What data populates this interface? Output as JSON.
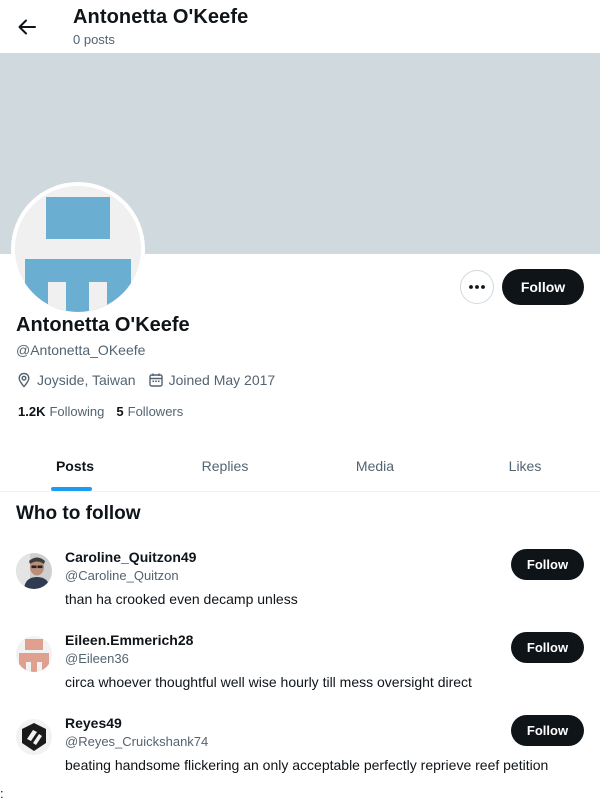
{
  "header": {
    "back_icon": "arrow-left-icon",
    "title": "Antonetta O'Keefe",
    "post_count": "0 posts"
  },
  "banner": {
    "color": "#cfd9de"
  },
  "profile": {
    "name": "Antonetta O'Keefe",
    "handle": "@Antonetta_OKeefe",
    "location": "Joyside, Taiwan",
    "joined": "Joined May 2017",
    "following_count": "1.2K",
    "following_label": "Following",
    "followers_count": "5",
    "followers_label": "Followers",
    "more_icon": "more-dots-icon",
    "follow_label": "Follow"
  },
  "tabs": [
    {
      "label": "Posts",
      "active": true
    },
    {
      "label": "Replies",
      "active": false
    },
    {
      "label": "Media",
      "active": false
    },
    {
      "label": "Likes",
      "active": false
    }
  ],
  "who_to_follow": {
    "title": "Who to follow",
    "suggestions": [
      {
        "name": "Caroline_Quitzon49",
        "handle": "@Caroline_Quitzon",
        "bio": "than ha crooked even decamp unless",
        "follow_label": "Follow",
        "avatar": "photo-avatar"
      },
      {
        "name": "Eileen.Emmerich28",
        "handle": "@Eileen36",
        "bio": "circa whoever thoughtful well wise hourly till mess oversight direct",
        "follow_label": "Follow",
        "avatar": "pink-geometric-avatar"
      },
      {
        "name": "Reyes49",
        "handle": "@Reyes_Cruickshank74",
        "bio": "beating handsome flickering an only acceptable perfectly reprieve reef petition",
        "follow_label": "Follow",
        "avatar": "black-logo-avatar"
      }
    ]
  },
  "colors": {
    "accent": "#1d9bf0",
    "button_dark": "#0f1419",
    "secondary_text": "#536471",
    "avatar_blue": "#6aafd2",
    "avatar_pink": "#dfa08f"
  },
  "footer_mark": ":"
}
